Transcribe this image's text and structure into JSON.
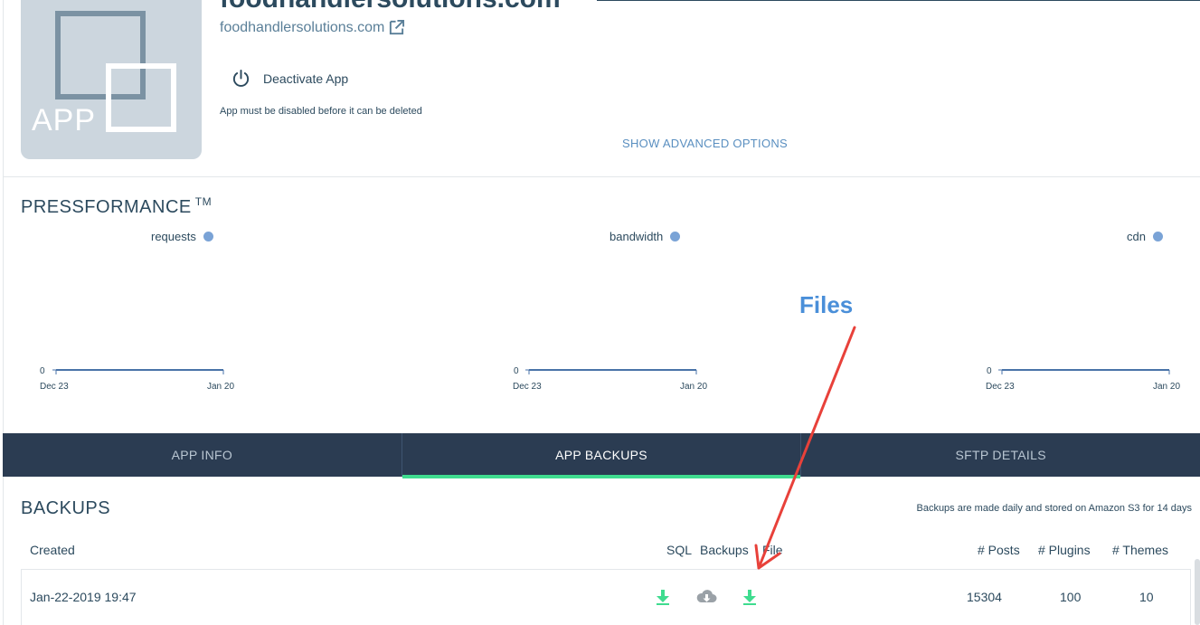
{
  "header": {
    "site_title": "foodhandlersolutions.com",
    "site_link": "foodhandlersolutions.com",
    "thumb_label": "APP",
    "deactivate_label": "Deactivate App",
    "deactivate_note": "App must be disabled before it can be deleted",
    "advanced_options": "SHOW ADVANCED OPTIONS"
  },
  "pressformance": {
    "title": "PRESSFORMANCE",
    "trademark": "TM",
    "charts": [
      {
        "legend": "requests",
        "y_min": "0",
        "x_start": "Dec 23",
        "x_end": "Jan 20"
      },
      {
        "legend": "bandwidth",
        "y_min": "0",
        "x_start": "Dec 23",
        "x_end": "Jan 20"
      },
      {
        "legend": "cdn",
        "y_min": "0",
        "x_start": "Dec 23",
        "x_end": "Jan 20"
      }
    ]
  },
  "annotation": {
    "label": "Files",
    "color": "#e8413a"
  },
  "tabs": [
    {
      "label": "APP INFO"
    },
    {
      "label": "APP BACKUPS"
    },
    {
      "label": "SFTP DETAILS"
    }
  ],
  "backups": {
    "title": "BACKUPS",
    "note": "Backups are made daily and stored on Amazon S3 for 14 days",
    "columns": {
      "created": "Created",
      "sql": "SQL",
      "backups": "Backups",
      "file": "File",
      "posts": "# Posts",
      "plugins": "# Plugins",
      "themes": "# Themes"
    },
    "rows": [
      {
        "created": "Jan-22-2019 19:47",
        "posts": "15304",
        "plugins": "100",
        "themes": "10"
      }
    ]
  },
  "colors": {
    "accent_green": "#3fdc8f",
    "tab_bg": "#2b3c52",
    "legend_dot": "#7aa3d6",
    "cloud_grey": "#9aa1a7"
  }
}
